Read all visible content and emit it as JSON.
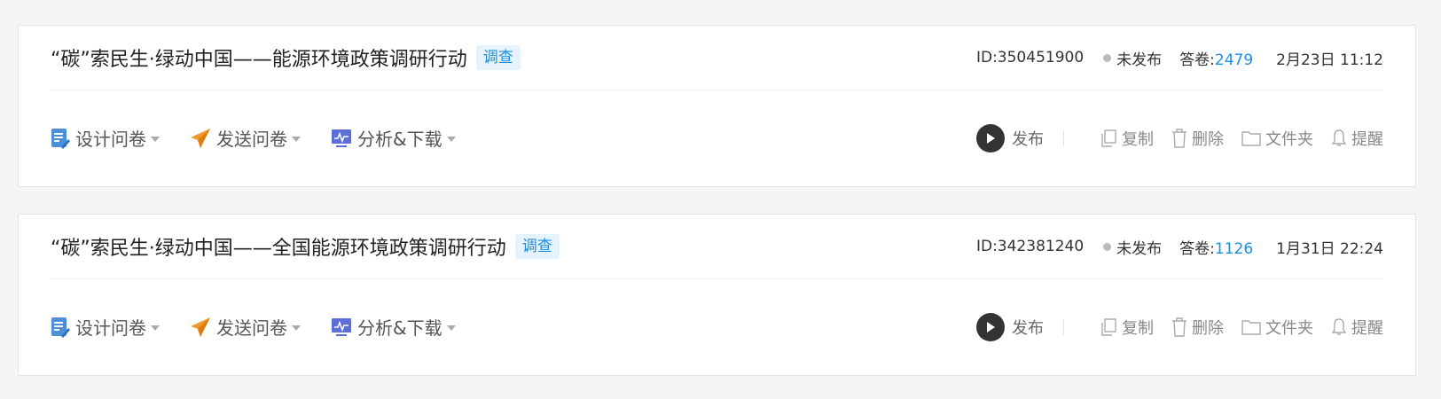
{
  "colors": {
    "accent": "#1a8fe0",
    "card_bg": "#ffffff",
    "page_bg": "#f5f5f5"
  },
  "surveys": [
    {
      "title": "“碳”索民生·绿动中国——能源环境政策调研行动",
      "tag": "调查",
      "id_text": "ID:350451900",
      "status": "未发布",
      "answers_label": "答卷:",
      "answers_count": "2479",
      "datetime": "2月23日 11:12"
    },
    {
      "title": "“碳”索民生·绿动中国——全国能源环境政策调研行动",
      "tag": "调查",
      "id_text": "ID:342381240",
      "status": "未发布",
      "answers_label": "答卷:",
      "answers_count": "1126",
      "datetime": "1月31日 22:24"
    }
  ],
  "actions": {
    "design": "设计问卷",
    "send": "发送问卷",
    "analyze": "分析&下载",
    "publish": "发布",
    "copy": "复制",
    "delete": "删除",
    "folder": "文件夹",
    "remind": "提醒"
  },
  "icons": {
    "design": "edit-document-icon",
    "send": "paper-plane-icon",
    "analyze": "chart-monitor-icon",
    "publish": "play-icon",
    "copy": "copy-icon",
    "delete": "trash-icon",
    "folder": "folder-icon",
    "remind": "bell-icon"
  }
}
